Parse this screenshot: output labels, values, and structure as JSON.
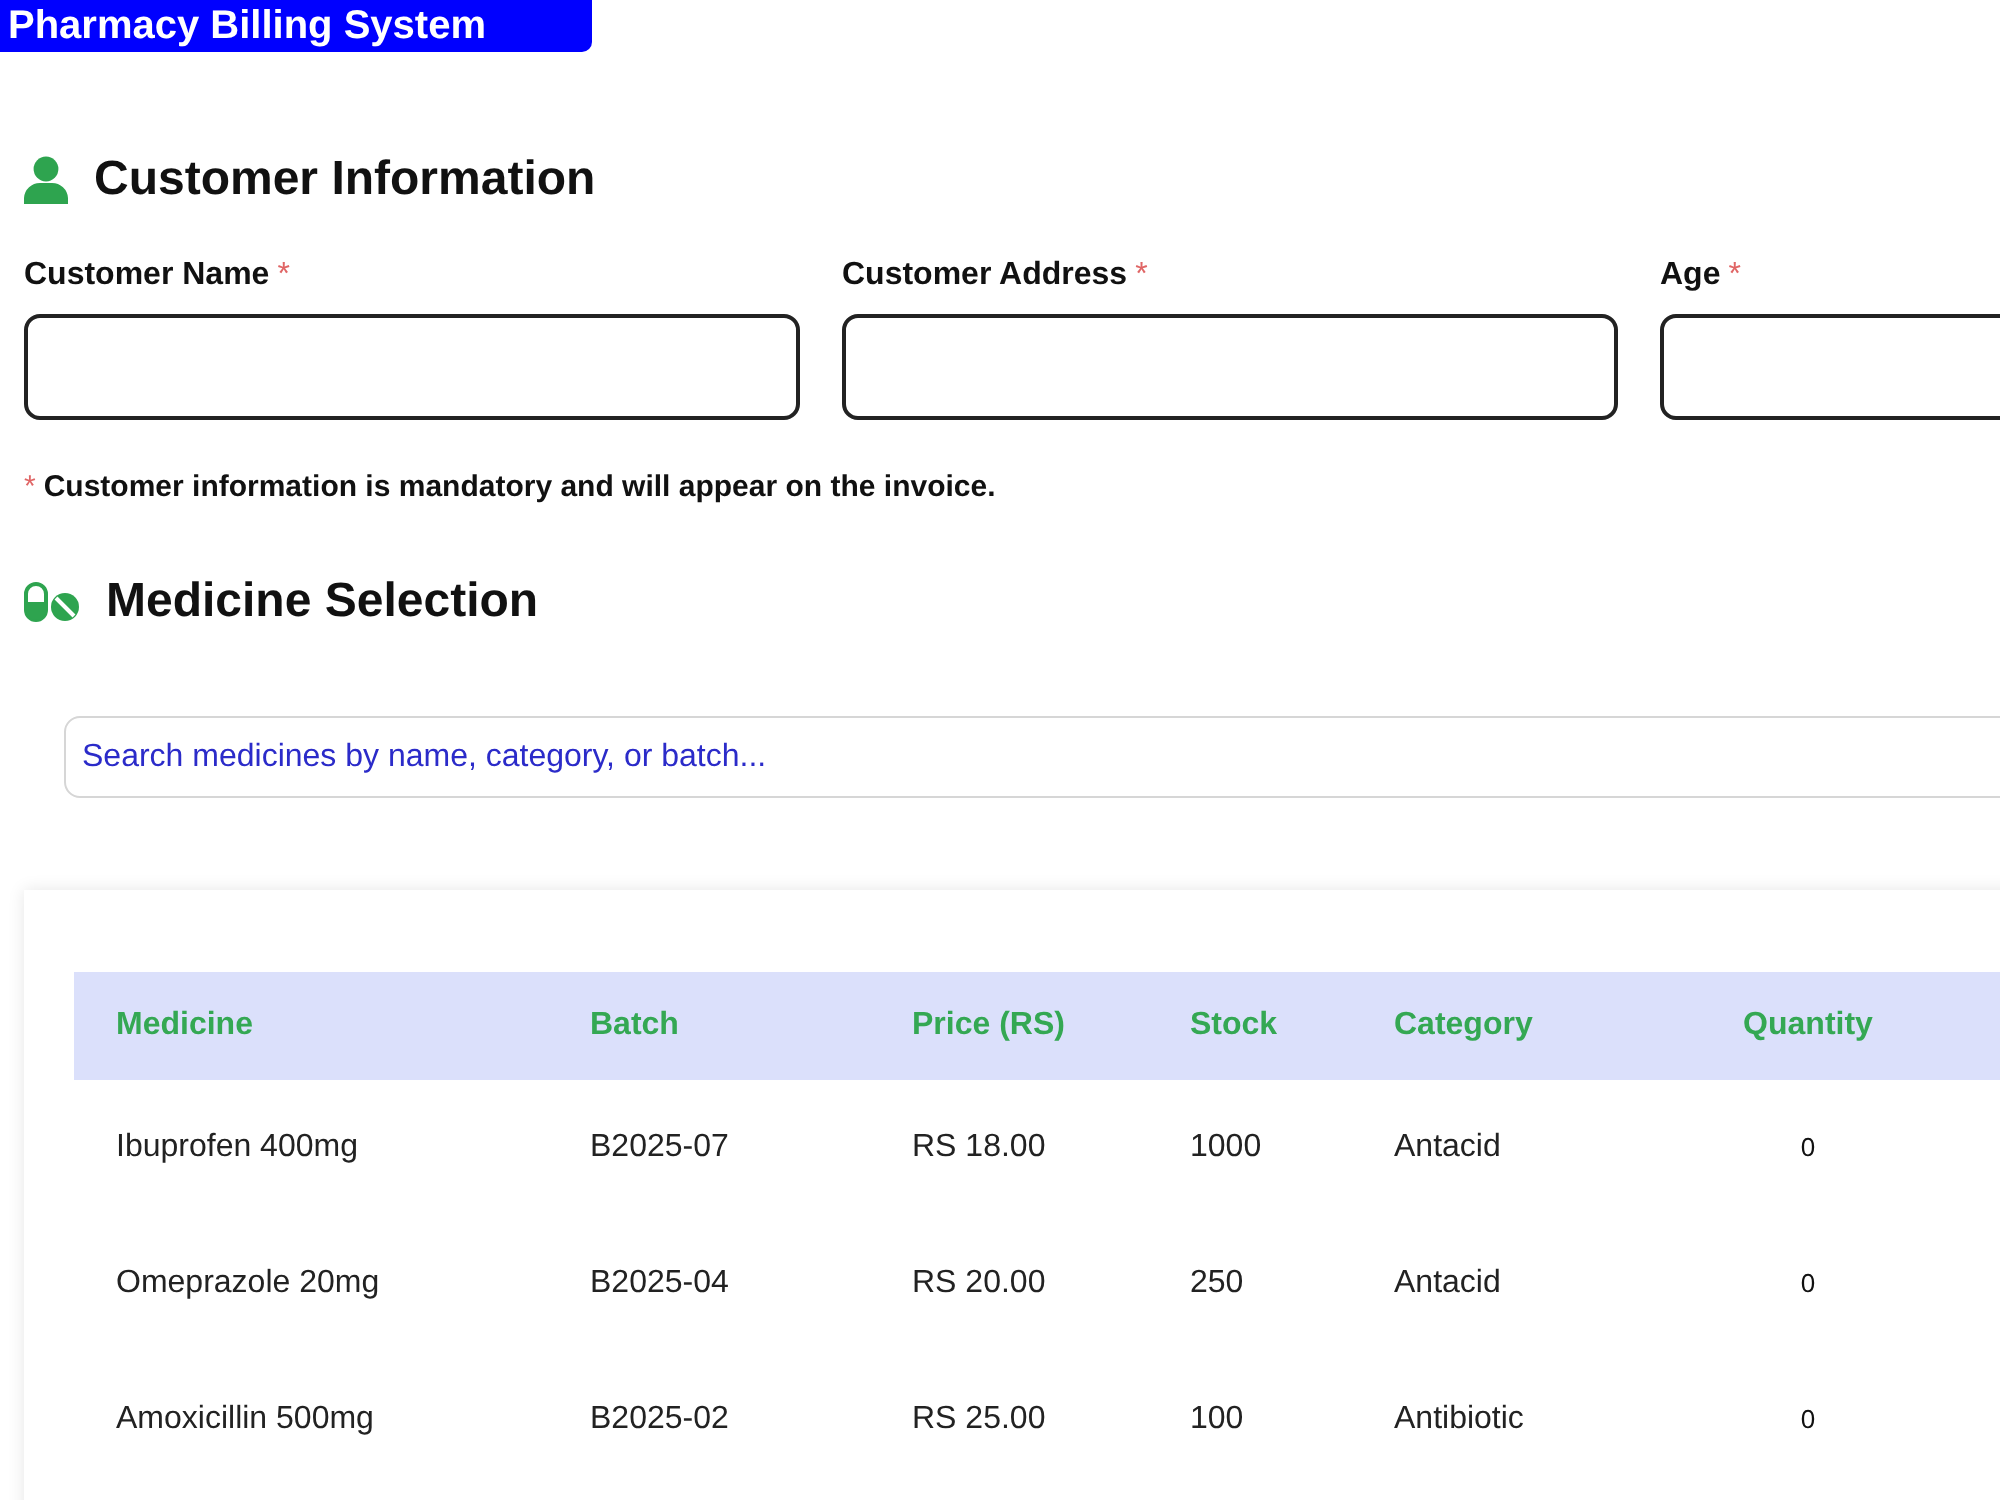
{
  "header": {
    "title": "Pharmacy Billing System"
  },
  "customer_information": {
    "title": "Customer Information",
    "fields": [
      {
        "label": "Customer Name",
        "required_mark": "*"
      },
      {
        "label": "Customer Address",
        "required_mark": "*"
      },
      {
        "label": "Age",
        "required_mark": "*"
      }
    ],
    "note": {
      "mark": "*",
      "text": "Customer information is mandatory and will appear on the invoice."
    }
  },
  "medicine_selection": {
    "title": "Medicine Selection",
    "search": {
      "placeholder": "Search medicines by name, category, or batch..."
    },
    "table": {
      "columns": [
        "Medicine",
        "Batch",
        "Price (RS)",
        "Stock",
        "Category",
        "Quantity"
      ],
      "rows": [
        {
          "medicine": "Ibuprofen 400mg",
          "batch": "B2025-07",
          "price": "RS 18.00",
          "stock": "1000",
          "category": "Antacid",
          "quantity": "0"
        },
        {
          "medicine": "Omeprazole 20mg",
          "batch": "B2025-04",
          "price": "RS 20.00",
          "stock": "250",
          "category": "Antacid",
          "quantity": "0"
        },
        {
          "medicine": "Amoxicillin 500mg",
          "batch": "B2025-02",
          "price": "RS 25.00",
          "stock": "100",
          "category": "Antibiotic",
          "quantity": "0"
        }
      ]
    }
  }
}
